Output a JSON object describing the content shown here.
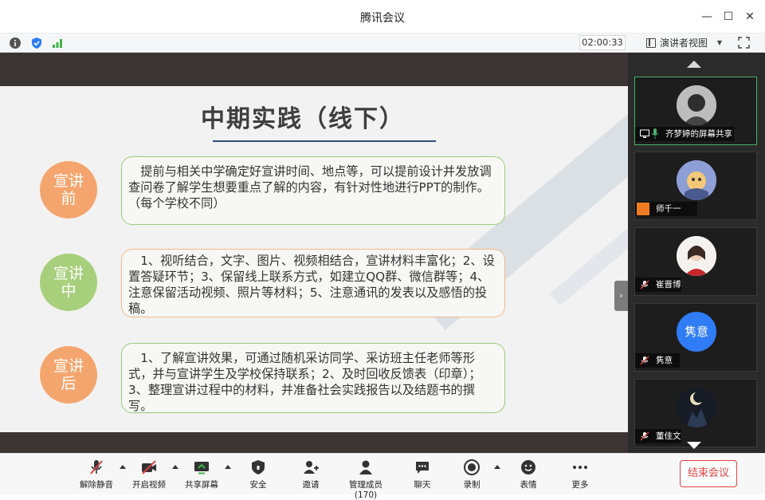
{
  "window": {
    "title": "腾讯会议"
  },
  "infobar": {
    "timer": "02:00:33",
    "view_mode": "演讲者视图"
  },
  "slide": {
    "title": "中期实践（线下）",
    "stages": [
      {
        "label_1": "宣讲",
        "label_2": "前",
        "color": "#f4a56e",
        "border": "#9ccc7a",
        "text": "提前与相关中学确定好宣讲时间、地点等，可以提前设计并发放调查问卷了解学生想要重点了解的内容，有针对性地进行PPT的制作。（每个学校不同）"
      },
      {
        "label_1": "宣讲",
        "label_2": "中",
        "color": "#a7cf7c",
        "border": "#f1b98b",
        "text": "1、视听结合，文字、图片、视频相结合，宣讲材料丰富化；2、设置答疑环节；3、保留线上联系方式，如建立QQ群、微信群等；4、注意保留活动视频、照片等材料；5、注意通讯的发表以及感悟的投稿。"
      },
      {
        "label_1": "宣讲",
        "label_2": "后",
        "color": "#f4a56e",
        "border": "#9ccc7a",
        "text": "1、了解宣讲效果，可通过随机采访同学、采访班主任老师等形式，并与宣讲学生及学校保持联系；2、及时回收反馈表（印章）；3、整理宣讲过程中的材料，并准备社会实践报告以及结题书的撰写。"
      }
    ]
  },
  "participants": [
    {
      "name": "齐梦婷的屏幕共享",
      "avatar_icon": "photo-avatar-icon"
    },
    {
      "name": "师千一",
      "avatar_icon": "cartoon-avatar-icon"
    },
    {
      "name": "崔晋博",
      "avatar_icon": "photo-avatar-icon"
    },
    {
      "name": "隽意",
      "avatar_text": "隽意",
      "avatar_icon": "text-avatar-icon"
    },
    {
      "name": "董佳文",
      "avatar_icon": "moon-avatar-icon"
    }
  ],
  "toolbar": {
    "mute": "解除静音",
    "video": "开启视频",
    "share": "共享屏幕",
    "security": "安全",
    "invite": "邀请",
    "members": "管理成员(170)",
    "chat": "聊天",
    "record": "录制",
    "reactions": "表情",
    "more": "更多",
    "end": "结束会议"
  },
  "colors": {
    "accent": "#2f7cf6",
    "end": "#e0413f",
    "active_tile": "#45b06b"
  }
}
